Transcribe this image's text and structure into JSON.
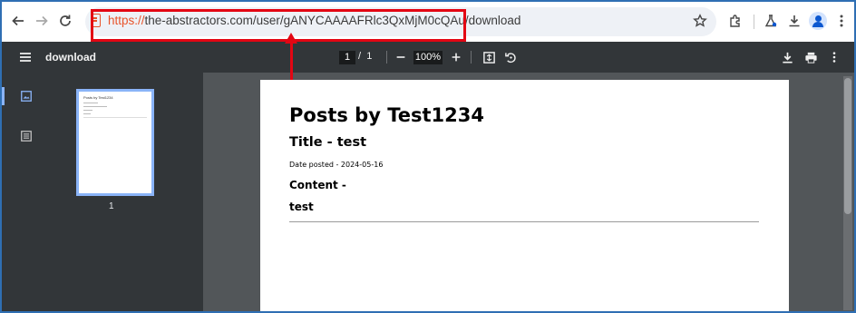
{
  "browser": {
    "url_scheme": "https://",
    "url_rest": "the-abstractors.com/user/gANYCAAAAFRlc3QxMjM0cQAu/download"
  },
  "pdf_viewer": {
    "title": "download",
    "current_page": "1",
    "page_separator": "/",
    "total_pages": "1",
    "zoom": "100%",
    "thumbnail_label": "1",
    "thumbnail": {
      "title": "Posts by Test1234"
    }
  },
  "document": {
    "heading": "Posts by Test1234",
    "post_title": "Title - test",
    "date_posted": "Date posted - 2024-05-16",
    "content_label": "Content -",
    "content_body": "test"
  },
  "colors": {
    "highlight": "#e30613",
    "viewer_dark": "#323639",
    "viewer_bg": "#525659",
    "accent": "#8ab4f8"
  }
}
